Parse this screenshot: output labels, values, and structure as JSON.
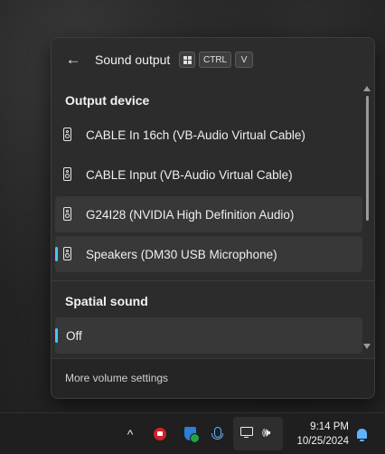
{
  "panel": {
    "back_label": "←",
    "title": "Sound output",
    "shortcut_keys": [
      "CTRL",
      "V"
    ]
  },
  "output": {
    "heading": "Output device",
    "devices": [
      {
        "label": "CABLE In 16ch (VB-Audio Virtual Cable)",
        "selected": false
      },
      {
        "label": "CABLE Input (VB-Audio Virtual Cable)",
        "selected": false
      },
      {
        "label": "G24I28 (NVIDIA High Definition Audio)",
        "selected": false
      },
      {
        "label": "Speakers (DM30 USB Microphone)",
        "selected": true
      }
    ]
  },
  "spatial": {
    "heading": "Spatial sound",
    "options": [
      {
        "label": "Off",
        "selected": true
      }
    ]
  },
  "footer": {
    "link_label": "More volume settings"
  },
  "taskbar": {
    "chevron": "^",
    "volume_glyph": "🕪",
    "time": "9:14 PM",
    "date": "10/25/2024"
  },
  "colors": {
    "accent": "#4cc2ff",
    "panel_bg": "#2c2c2c"
  }
}
